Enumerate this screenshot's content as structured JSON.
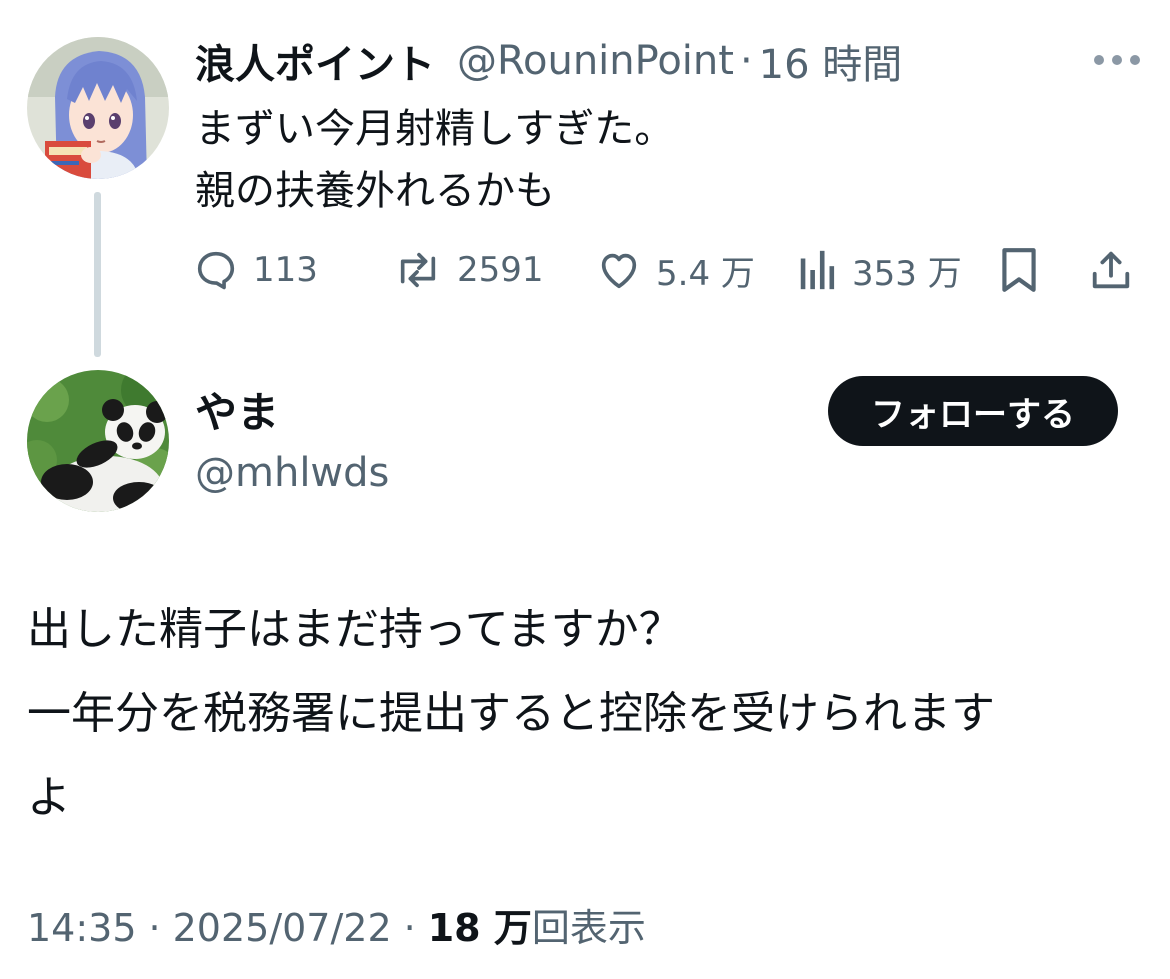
{
  "original_tweet": {
    "author_name": "浪人ポイント",
    "handle": "@RouninPoint",
    "separator": "·",
    "time_ago": "16 時間",
    "text_lines": [
      "まずい今月射精しすぎた。",
      "親の扶養外れるかも"
    ],
    "avatar_icon": "anime-character-avatar",
    "metrics": {
      "replies": "113",
      "retweets": "2591",
      "likes": "5.4 万",
      "views": "353 万"
    }
  },
  "reply_tweet": {
    "author_name": "やま",
    "handle": "@mhlwds",
    "avatar_icon": "panda-avatar",
    "follow_label": "フォローする",
    "text_lines": [
      "出した精子はまだ持ってますか？",
      "一年分を税務署に提出すると控除を受けられます",
      "よ"
    ],
    "time": "14:35",
    "separator": "·",
    "date": "2025/07/22",
    "views_count": "18 万",
    "views_label": "回表示"
  },
  "colors": {
    "text_primary": "#0f1419",
    "text_secondary": "#536471",
    "thread_line": "#cfd9de",
    "button_bg": "#0f1419",
    "button_text": "#ffffff"
  }
}
